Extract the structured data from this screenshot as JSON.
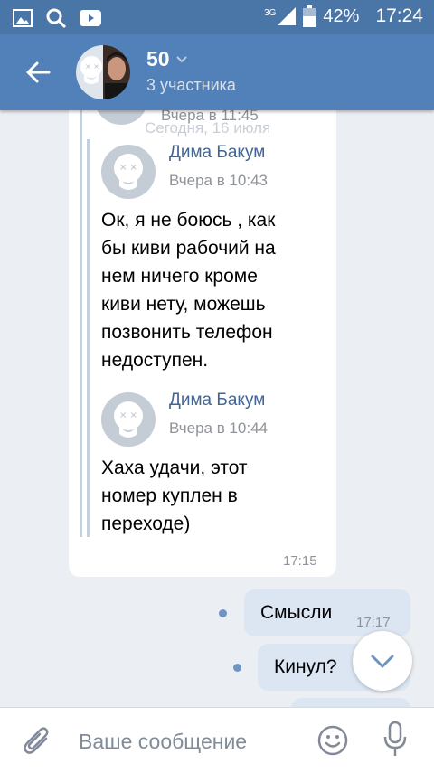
{
  "status_bar": {
    "network": "3G",
    "battery": "42%",
    "time": "17:24"
  },
  "header": {
    "title": "50",
    "subtitle": "3 участника"
  },
  "date_separator": "Сегодня, 16 июля",
  "quoted_top_time": "Вчера в 11:45",
  "forwarded": [
    {
      "author": "Дима Бакум",
      "time": "Вчера в 10:43",
      "lines": [
        "Ок, я не боюсь , как",
        "бы киви рабочий на",
        "нем ничего кроме",
        "киви нету, можешь",
        "позвонить телефон",
        "недоступен."
      ]
    },
    {
      "author": "Дима Бакум",
      "time": "Вчера в 10:44",
      "lines": [
        "Хаха удачи, этот",
        "номер куплен в",
        "переходе)"
      ]
    }
  ],
  "incoming_time": "17:15",
  "outgoing": [
    {
      "text": "Смысли",
      "time": "17:17"
    },
    {
      "text": "Кинул?",
      "time": ""
    }
  ],
  "input": {
    "placeholder": "Ваше сообщение"
  }
}
